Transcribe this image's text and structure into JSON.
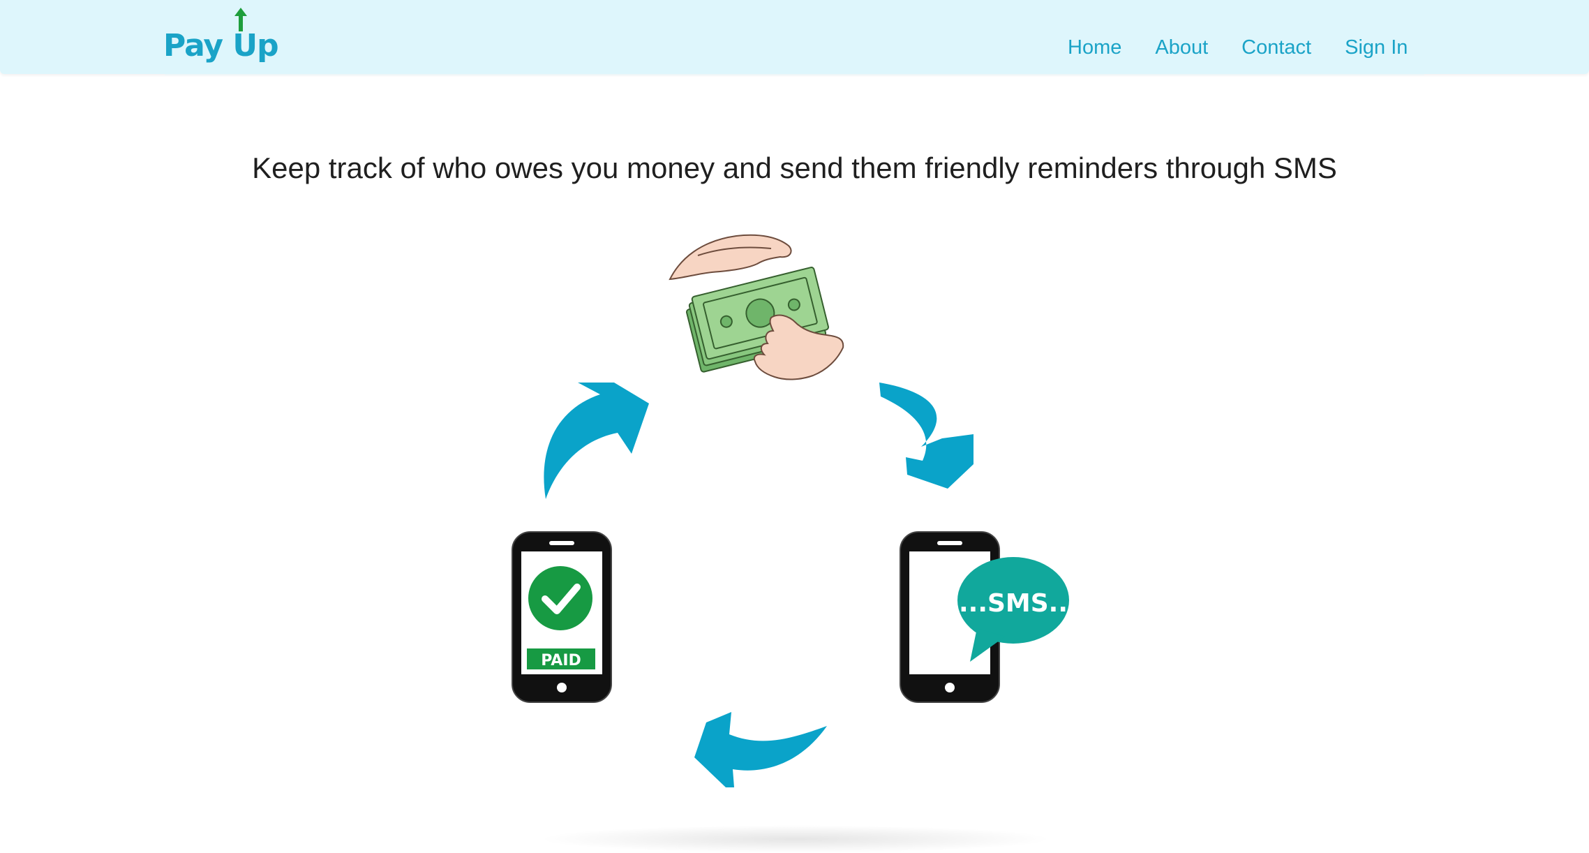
{
  "brand": {
    "name": "Pay Up",
    "accent_color": "#1aa3c7",
    "arrow_color": "#1e9e3c"
  },
  "nav": {
    "items": [
      {
        "label": "Home"
      },
      {
        "label": "About"
      },
      {
        "label": "Contact"
      },
      {
        "label": "Sign In"
      }
    ],
    "background_color": "#def6fc"
  },
  "hero": {
    "tagline": "Keep track of who owes you money and send them friendly reminders through SMS"
  },
  "illustration": {
    "paid_label": "PAID",
    "sms_label": "...SMS..",
    "arrow_color": "#0aa3c9",
    "check_color": "#179a43",
    "sms_bubble_color": "#11a89c",
    "money_color": "#8fce84",
    "steps": [
      "money-handoff",
      "sms-reminder",
      "paid-confirmation"
    ]
  }
}
